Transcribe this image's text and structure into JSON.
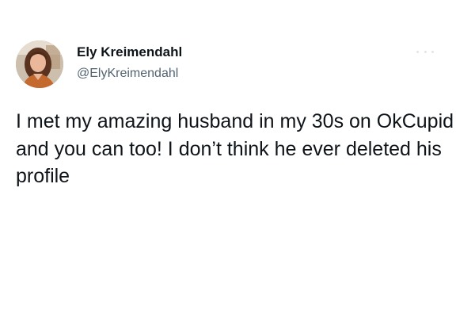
{
  "tweet": {
    "author": {
      "display_name": "Ely Kreimendahl",
      "handle": "@ElyKreimendahl",
      "avatar_icon": "profile-photo"
    },
    "text": "I met my amazing husband in my 30s on OkCupid and you can too! I don’t think he ever deleted his profile",
    "more_icon": "more-options-icon"
  },
  "colors": {
    "background": "#ffffff",
    "primary_text": "#0f1419",
    "secondary_text": "#536471"
  }
}
